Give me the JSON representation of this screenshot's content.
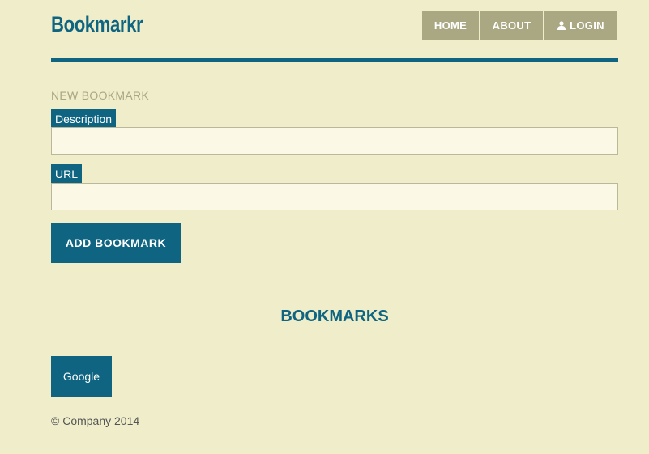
{
  "header": {
    "logo": "Bookmarkr",
    "nav": {
      "home": "HOME",
      "about": "ABOUT",
      "login": "LOGIN"
    }
  },
  "form": {
    "section_title": "NEW BOOKMARK",
    "description_label": "Description",
    "description_value": "",
    "url_label": "URL",
    "url_value": "",
    "submit_label": "ADD BOOKMARK"
  },
  "bookmarks": {
    "title": "BOOKMARKS",
    "items": [
      {
        "label": "Google"
      }
    ]
  },
  "footer": {
    "text": "© Company 2014"
  },
  "colors": {
    "background": "#efedca",
    "primary": "#0f6581",
    "nav_bg": "#a9a882",
    "input_bg": "#fbf9e5"
  },
  "icons": {
    "login": "user-icon"
  }
}
